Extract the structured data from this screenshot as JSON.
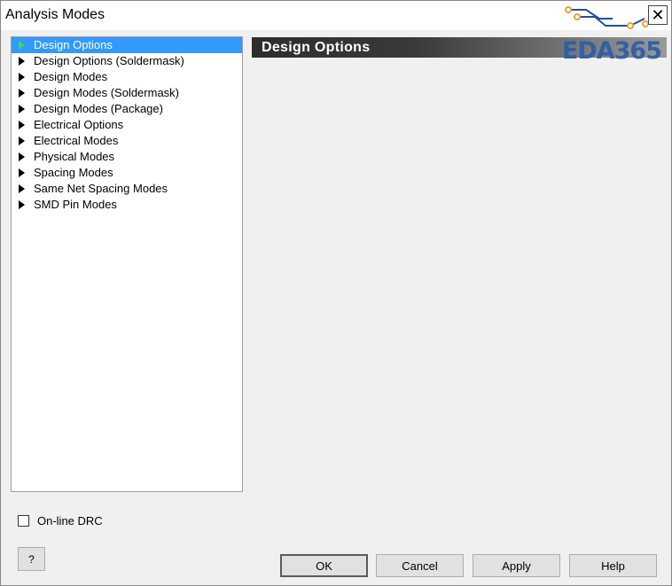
{
  "window": {
    "title": "Analysis Modes",
    "close_glyph": "✕",
    "watermark": "EDA365"
  },
  "tree": {
    "items": [
      {
        "label": "Design Options",
        "selected": true
      },
      {
        "label": "Design Options (Soldermask)"
      },
      {
        "label": "Design Modes"
      },
      {
        "label": "Design Modes (Soldermask)"
      },
      {
        "label": "Design Modes (Package)"
      },
      {
        "label": "Electrical Options"
      },
      {
        "label": "Electrical Modes"
      },
      {
        "label": "Physical Modes"
      },
      {
        "label": "Spacing Modes"
      },
      {
        "label": "Same Net Spacing Modes"
      },
      {
        "label": "SMD Pin Modes"
      }
    ]
  },
  "content": {
    "header_title": "Design Options"
  },
  "options": {
    "online_drc_label": "On-line DRC",
    "online_drc_checked": false
  },
  "buttons": {
    "help_q": "?",
    "ok": "OK",
    "cancel": "Cancel",
    "apply": "Apply",
    "help": "Help"
  },
  "colors": {
    "selection": "#3399ff",
    "selected_arrow": "#33dd55",
    "watermark": "#2a5ea8",
    "logo_trace": "#1f4f9e",
    "logo_pad": "#f0a030"
  }
}
